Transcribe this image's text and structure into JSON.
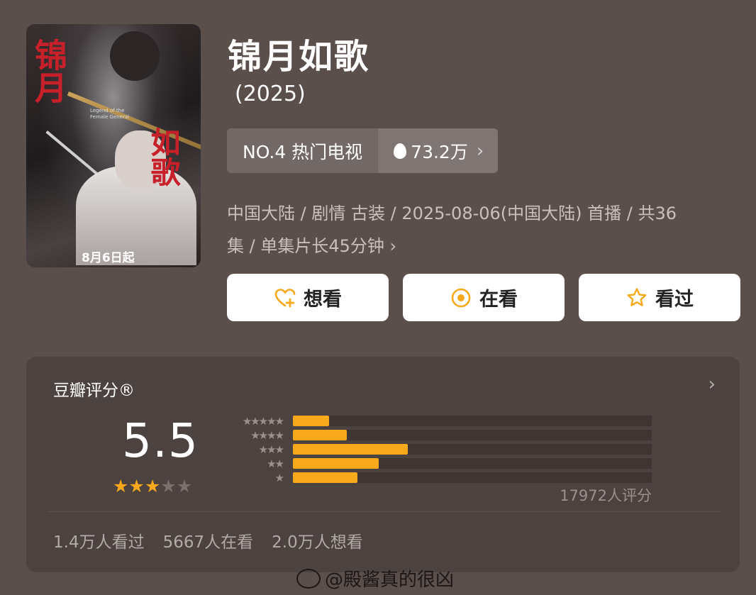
{
  "poster": {
    "calligraphy_top": "锦月",
    "calligraphy_bottom": "如歌",
    "english_subtitle": "Legend of the Female General",
    "premiere_text": "8月6日起"
  },
  "show": {
    "title": "锦月如歌",
    "year": "(2025)"
  },
  "ranking": {
    "rank_label": "NO.4 热门电视",
    "heat_value": "73.2万",
    "heat_icon": "flame-icon"
  },
  "meta": {
    "line1": "中国大陆 / 剧情 古装 / 2025-08-06(中国大陆) 首播 / 共36",
    "line2": "集 / 单集片长45分钟"
  },
  "actions": {
    "want": "想看",
    "watching": "在看",
    "watched": "看过"
  },
  "rating": {
    "title": "豆瓣评分®",
    "score": "5.5",
    "stars_filled": 3,
    "stars_total": 5,
    "distribution_fraction": [
      0.1,
      0.15,
      0.32,
      0.24,
      0.18
    ],
    "rating_count": "17972人评分",
    "watched_count": "1.4万人看过",
    "watching_count": "5667人在看",
    "want_count": "2.0万人想看"
  },
  "watermark": {
    "text": "@殿酱真的很凶"
  },
  "colors": {
    "accent_orange": "#f7a81b",
    "background": "#5b4f4c",
    "card": "#4c4240"
  }
}
